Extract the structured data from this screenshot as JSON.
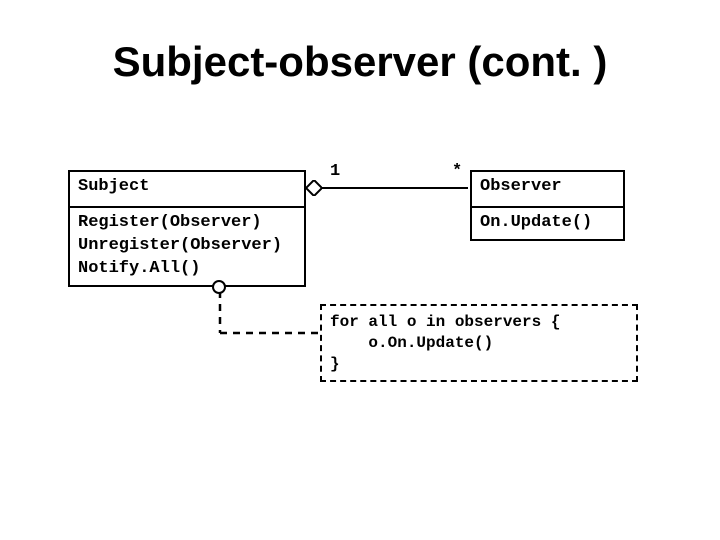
{
  "title": "Subject-observer (cont. )",
  "subject": {
    "name": "Subject",
    "methods": "Register(Observer)\nUnregister(Observer)\nNotify.All()"
  },
  "observer": {
    "name": "Observer",
    "methods": "On.Update()"
  },
  "multiplicity": {
    "subject_end": "1",
    "observer_end": "*"
  },
  "note": "for all o in observers {\n    o.On.Update()\n}"
}
